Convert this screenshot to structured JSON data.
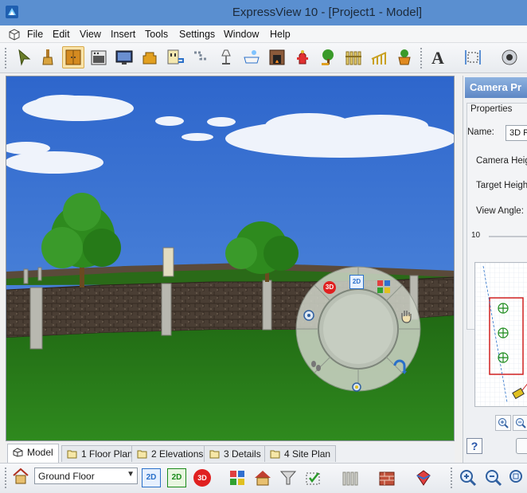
{
  "window": {
    "title": "ExpressView 10 - [Project1 - Model]"
  },
  "menu": {
    "items": [
      "File",
      "Edit",
      "View",
      "Insert",
      "Tools",
      "Settings",
      "Window",
      "Help"
    ]
  },
  "toolbar": {
    "icons": [
      "select-arrow-icon",
      "paintbrush-icon",
      "cabinet-icon",
      "appliance-icon",
      "tv-icon",
      "armchair-icon",
      "electrical-icon",
      "plumbing-icon",
      "lamp-icon",
      "bath-icon",
      "fireplace-icon",
      "hydrant-icon",
      "tree-icon",
      "fence-icon",
      "railing-icon",
      "planter-icon",
      "text-icon",
      "dimension-icon",
      "camera-icon"
    ],
    "active_icon": "cabinet-icon"
  },
  "navigator": {
    "badges": [
      "3D",
      "2D"
    ]
  },
  "camera_panel": {
    "header": "Camera Pr",
    "section_title": "Properties",
    "name_label": "Name:",
    "name_value": "3D P",
    "camera_height_label": "Camera Heigh",
    "target_height_label": "Target Heigh",
    "view_angle_label": "View Angle:",
    "view_angle_value": "10",
    "help_label": "?"
  },
  "tabs": [
    {
      "label": "Model",
      "active": true
    },
    {
      "label": "1 Floor Plan",
      "active": false
    },
    {
      "label": "2 Elevations",
      "active": false
    },
    {
      "label": "3 Details",
      "active": false
    },
    {
      "label": "4 Site Plan",
      "active": false
    }
  ],
  "bottombar": {
    "floor_value": "Ground Floor",
    "view_2d_label": "2D",
    "view_2d_grid_label": "2D",
    "view_3d_label": "3D"
  },
  "colors": {
    "titlebar": "#5a8fd0",
    "sky": "#3f78d6",
    "grass": "#2a7a1a",
    "wall": "#4a3e34",
    "panel_header": "#5d87c5"
  }
}
